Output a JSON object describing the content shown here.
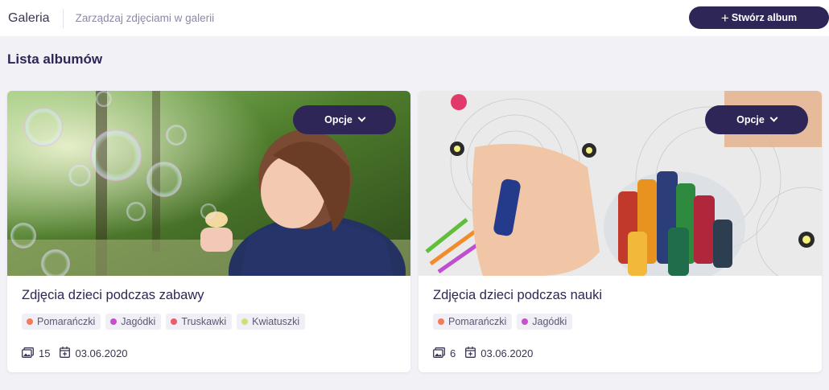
{
  "header": {
    "title": "Galeria",
    "subtitle": "Zarządzaj zdjęciami w galerii",
    "create_button_icon": "+",
    "create_button_label": "Stwórz album"
  },
  "section": {
    "title": "Lista albumów"
  },
  "albums": [
    {
      "options_label": "Opcje",
      "title": "Zdjęcia dzieci podczas zabawy",
      "tags": [
        {
          "label": "Pomarańczki",
          "color": "#f47a5a"
        },
        {
          "label": "Jagódki",
          "color": "#c44fcf"
        },
        {
          "label": "Truskawki",
          "color": "#ef5a6a"
        },
        {
          "label": "Kwiatuszki",
          "color": "#c8e37a"
        }
      ],
      "photo_count": "15",
      "date": "03.06.2020"
    },
    {
      "options_label": "Opcje",
      "title": "Zdjęcia dzieci podczas nauki",
      "tags": [
        {
          "label": "Pomarańczki",
          "color": "#f47a5a"
        },
        {
          "label": "Jagódki",
          "color": "#c44fcf"
        }
      ],
      "photo_count": "6",
      "date": "03.06.2020"
    }
  ],
  "colors": {
    "accent": "#2d2657",
    "background": "#f1f1f6"
  },
  "icons": {
    "photos": "images-icon",
    "date": "calendar-icon",
    "options": "chevron-down-icon"
  }
}
